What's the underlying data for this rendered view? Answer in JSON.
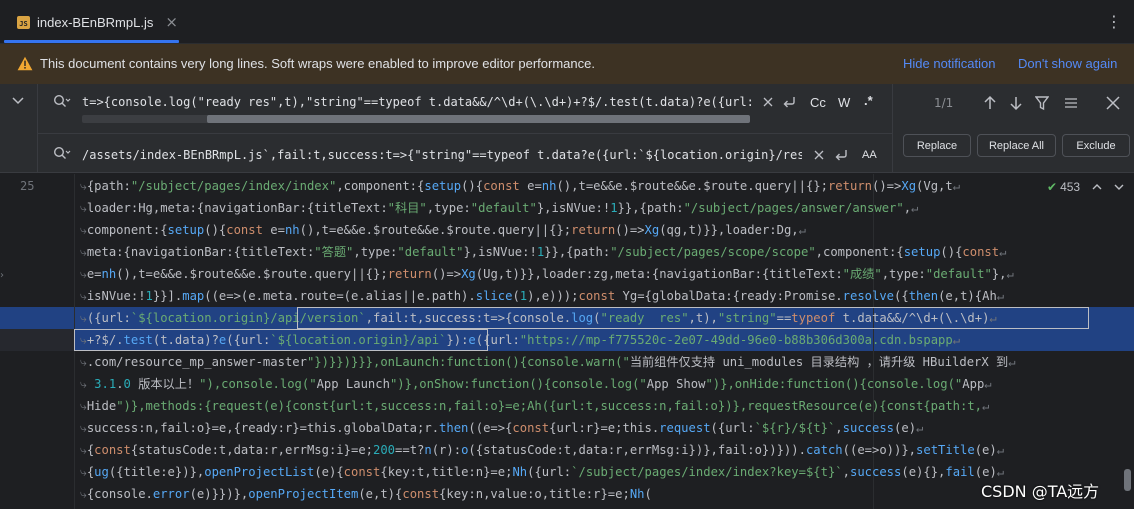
{
  "tab": {
    "title": "index-BEnBRmpL.js",
    "close_glyph": "×",
    "icon_label": "JS"
  },
  "menu_glyph": "⋮",
  "notification": {
    "text": "This document contains very long lines. Soft wraps were enabled to improve editor performance.",
    "hide_label": "Hide notification",
    "dont_show_label": "Don't show again",
    "warning_color": "#f0a732"
  },
  "find": {
    "query": "t=>{console.log(\"ready  res\",t),\"string\"==typeof t.data&&/^\\d+(\\.\\d+)+?$/.test(t.data)?e({url:`${location.origin}/api`",
    "match_count": "1/1",
    "case_label": "Cc",
    "word_label": "W",
    "regex_label": ".*"
  },
  "replace": {
    "value": "/assets/index-BEnBRmpL.js`,fail:t,success:t=>{\"string\"==typeof t.data?e({url:`${location.origin}/resource_mp_answer`",
    "preserve_case_label": "AA",
    "replace_label": "Replace",
    "replace_all_label": "Replace All",
    "exclude_label": "Exclude"
  },
  "editor": {
    "line_number": "25",
    "inspection_count": "453",
    "accent_color": "#3574f0",
    "selection_color": "#214283",
    "lines": [
      "{path:\"/subject/pages/index/index\",component:{setup(){const e=nh(),t=e&&e.$route&&e.$route.query||{};return()=>Xg(Vg,t",
      "loader:Hg,meta:{navigationBar:{titleText:\"科目\",type:\"default\"},isNVue:!1}},{path:\"/subject/pages/answer/answer\",",
      "component:{setup(){const e=nh(),t=e&&e.$route&&e.$route.query||{};return()=>Xg(qg,t)}},loader:Dg,",
      "meta:{navigationBar:{titleText:\"答题\",type:\"default\"},isNVue:!1}},{path:\"/subject/pages/scope/scope\",component:{setup(){const",
      "e=nh(),t=e&&e.$route&&e.$route.query||{};return()=>Xg(Ug,t)}},loader:zg,meta:{navigationBar:{titleText:\"成绩\",type:\"default\"},",
      "isNVue:!1}}].map((e=>(e.meta.route=(e.alias||e.path).slice(1),e)));const Yg={globalData:{ready:Promise.resolve({then(e,t){Ah",
      "({url:`${location.origin}/api/version`,fail:t,success:t=>{console.log(\"ready  res\",t),\"string\"==typeof t.data&&/^\\d+(\\.\\d+)",
      "+?$/.test(t.data)?e({url:`${location.origin}/api`}):e({url:\"https://mp-f775520c-2e07-49dd-96e0-b88b306d300a.cdn.bspapp",
      ".com/resource_mp_answer-master\"})}})}}},onLaunch:function(){console.warn(\"当前组件仅支持 uni_modules 目录结构 ，请升级 HBuilderX 到",
      " 3.1.0 版本以上！\"),console.log(\"App Launch\")},onShow:function(){console.log(\"App Show\")},onHide:function(){console.log(\"App",
      "Hide\")},methods:{request(e){const{url:t,success:n,fail:o}=e;Ah({url:t,success:n,fail:o})},requestResource(e){const{path:t,",
      "success:n,fail:o}=e,{ready:r}=this.globalData;r.then((e=>{const{url:r}=e;this.request({url:`${r}/${t}`,success(e)",
      "{const{statusCode:t,data:r,errMsg:i}=e;200==t?n(r):o({statusCode:t,data:r,errMsg:i})},fail:o})})).catch((e=>o))},setTitle(e)",
      "{ug({title:e})},openProjectList(e){const{key:t,title:n}=e;Nh({url:`/subject/pages/index/index?key=${t}`,success(e){},fail(e)",
      "{console.error(e)}})},openProjectItem(e,t){const{key:n,value:o,title:r}=e;Nh("
    ]
  },
  "watermark": "CSDN @TA远方"
}
